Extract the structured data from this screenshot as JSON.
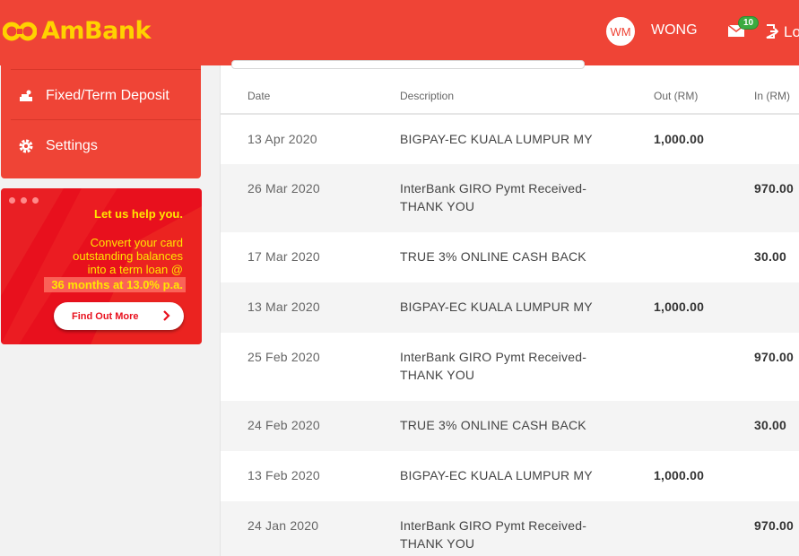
{
  "brand": {
    "name": "AmBank",
    "primary_color": "#ef4436",
    "accent_color": "#ffd200"
  },
  "header": {
    "avatar_initials": "WM",
    "username": "WONG",
    "mail_icon": "mail-icon",
    "mail_count": "10",
    "logout_label": "Lo"
  },
  "sidebar": {
    "items": [
      {
        "label": "Fixed/Term Deposit",
        "icon": "deposit-icon"
      },
      {
        "label": "Settings",
        "icon": "gear-icon"
      }
    ]
  },
  "promo": {
    "headline": "Let us help you.",
    "body_line1": "Convert your card",
    "body_line2": "outstanding balances",
    "body_line3": "into a term loan @",
    "highlight": "36 months at 13.0% p.a.",
    "button_label": "Find Out More"
  },
  "table": {
    "columns": [
      "Date",
      "Description",
      "Out (RM)",
      "In (RM)"
    ],
    "rows": [
      {
        "date": "13 Apr 2020",
        "desc1": "BIGPAY-EC KUALA LUMPUR MY",
        "desc2": "",
        "out": "1,000.00",
        "in": ""
      },
      {
        "date": "26 Mar 2020",
        "desc1": "InterBank GIRO Pymt Received-",
        "desc2": "THANK YOU",
        "out": "",
        "in": "970.00"
      },
      {
        "date": "17 Mar 2020",
        "desc1": "TRUE 3% ONLINE CASH BACK",
        "desc2": "",
        "out": "",
        "in": "30.00"
      },
      {
        "date": "13 Mar 2020",
        "desc1": "BIGPAY-EC KUALA LUMPUR MY",
        "desc2": "",
        "out": "1,000.00",
        "in": ""
      },
      {
        "date": "25 Feb 2020",
        "desc1": "InterBank GIRO Pymt Received-",
        "desc2": "THANK YOU",
        "out": "",
        "in": "970.00"
      },
      {
        "date": "24 Feb 2020",
        "desc1": "TRUE 3% ONLINE CASH BACK",
        "desc2": "",
        "out": "",
        "in": "30.00"
      },
      {
        "date": "13 Feb 2020",
        "desc1": "BIGPAY-EC KUALA LUMPUR MY",
        "desc2": "",
        "out": "1,000.00",
        "in": ""
      },
      {
        "date": "24 Jan 2020",
        "desc1": "InterBank GIRO Pymt Received-",
        "desc2": "THANK YOU",
        "out": "",
        "in": "970.00"
      }
    ]
  }
}
